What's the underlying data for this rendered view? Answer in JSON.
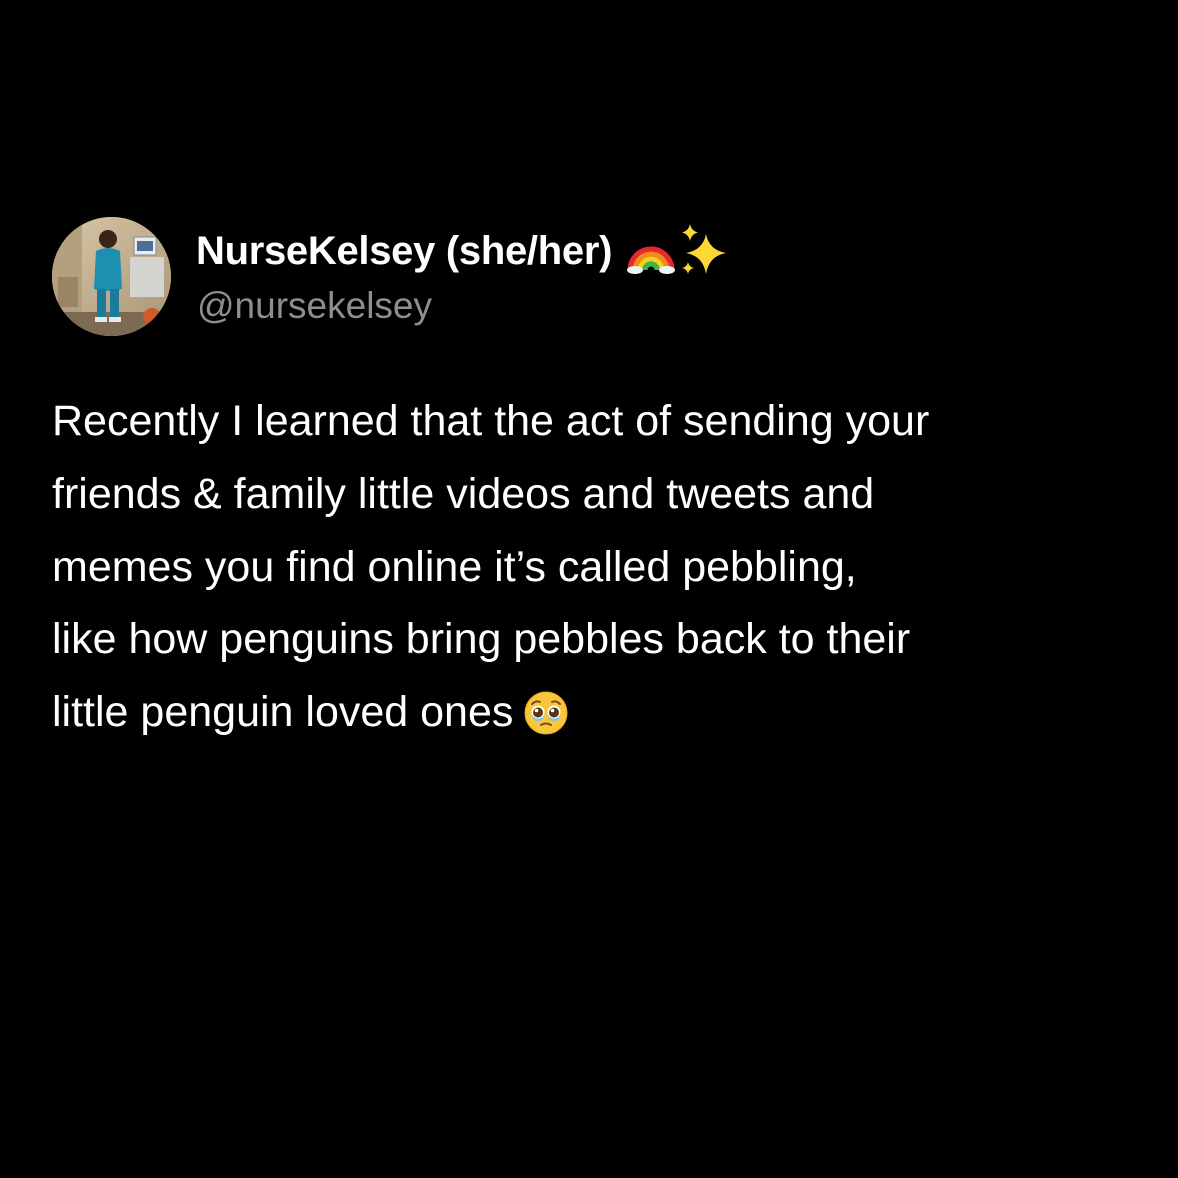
{
  "tweet": {
    "display_name": "NurseKelsey (she/her)",
    "name_emojis": [
      "rainbow-icon",
      "sparkles-icon"
    ],
    "handle": "@nursekelsey",
    "text_lines": [
      "Recently I learned that the act of sending your",
      "friends & family little videos and tweets and",
      "memes you find online it’s called pebbling,",
      "like how penguins bring pebbles back to their",
      "little penguin loved ones"
    ],
    "trailing_emoji": "pleading-face-icon"
  },
  "colors": {
    "background": "#000000",
    "text_primary": "#ffffff",
    "text_secondary": "#8b8f94"
  }
}
